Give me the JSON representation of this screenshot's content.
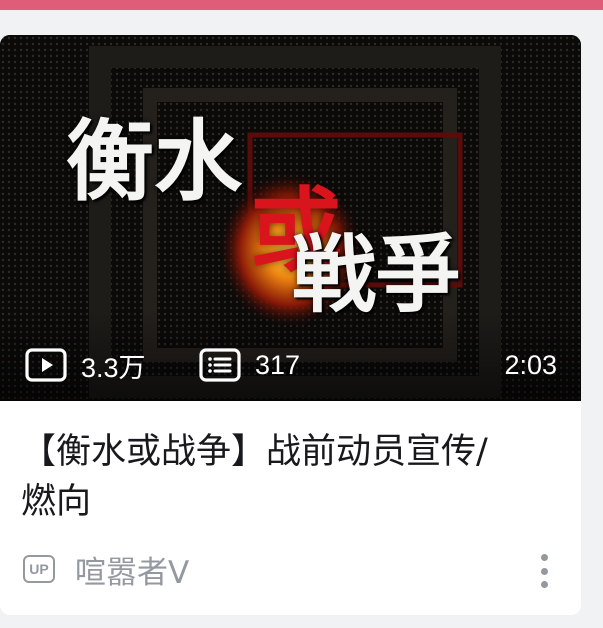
{
  "video": {
    "thumbnail_text": {
      "line1": "衡水",
      "accent": "或",
      "line2": "戦爭"
    },
    "play_count": "3.3万",
    "danmaku_count": "317",
    "duration": "2:03",
    "title": "【衡水或战争】战前动员宣传/燃向",
    "uploader": "喧嚣者V",
    "up_badge": "UP"
  },
  "icons": {
    "play": "play-count-icon",
    "danmaku": "danmaku-count-icon",
    "more": "more-vertical-icon",
    "up": "up-badge-icon"
  },
  "colors": {
    "top_bar": "#e05d7a",
    "accent_red": "#d9141c",
    "meta_gray": "#9499a0",
    "title_text": "#18191c"
  }
}
